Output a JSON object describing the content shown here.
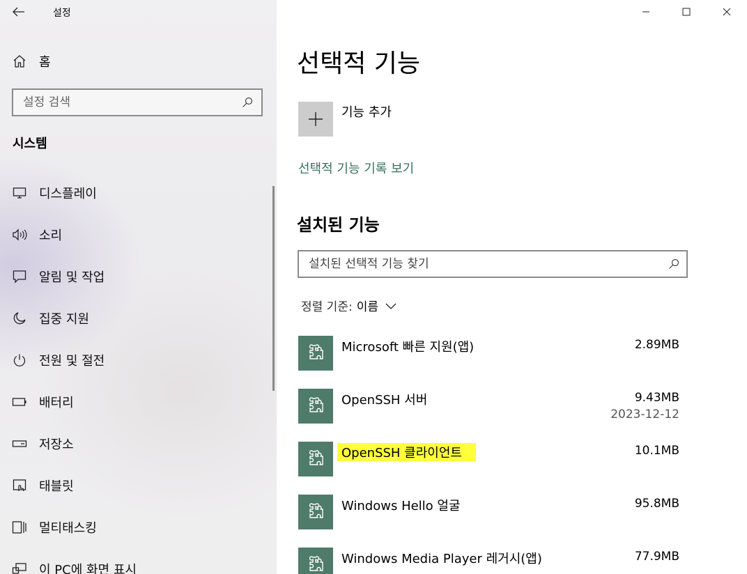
{
  "window": {
    "title": "설정",
    "back_icon": "back-arrow-icon",
    "controls": [
      "minimize-icon",
      "maximize-icon",
      "close-icon"
    ]
  },
  "nav": {
    "home_label": "홈",
    "search_placeholder": "설정 검색",
    "section_title": "시스템",
    "items": [
      {
        "label": "디스플레이",
        "icon": "display-icon"
      },
      {
        "label": "소리",
        "icon": "sound-icon"
      },
      {
        "label": "알림 및 작업",
        "icon": "notification-icon"
      },
      {
        "label": "집중 지원",
        "icon": "moon-icon"
      },
      {
        "label": "전원 및 절전",
        "icon": "power-icon"
      },
      {
        "label": "배터리",
        "icon": "battery-icon"
      },
      {
        "label": "저장소",
        "icon": "storage-icon"
      },
      {
        "label": "태블릿",
        "icon": "tablet-icon"
      },
      {
        "label": "멀티태스킹",
        "icon": "multitasking-icon"
      },
      {
        "label": "이 PC에 화면 표시",
        "icon": "project-icon"
      }
    ]
  },
  "main": {
    "title": "선택적 기능",
    "add_feature_label": "기능 추가",
    "history_link": "선택적 기능 기록 보기",
    "installed_title": "설치된 기능",
    "installed_search_placeholder": "설치된 선택적 기능 찾기",
    "sort_label": "정렬 기준:",
    "sort_value": "이름",
    "features": [
      {
        "name": "Microsoft 빠른 지원(앱)",
        "size": "2.89MB",
        "date": ""
      },
      {
        "name": "OpenSSH 서버",
        "size": "9.43MB",
        "date": "2023-12-12"
      },
      {
        "name": "OpenSSH 클라이언트",
        "size": "10.1MB",
        "date": ""
      },
      {
        "name": "Windows Hello 얼굴",
        "size": "95.8MB",
        "date": ""
      },
      {
        "name": "Windows Media Player 레거시(앱)",
        "size": "77.9MB",
        "date": ""
      }
    ],
    "highlight_color": "#ffff3a",
    "accent_color": "#4f7b6b"
  }
}
